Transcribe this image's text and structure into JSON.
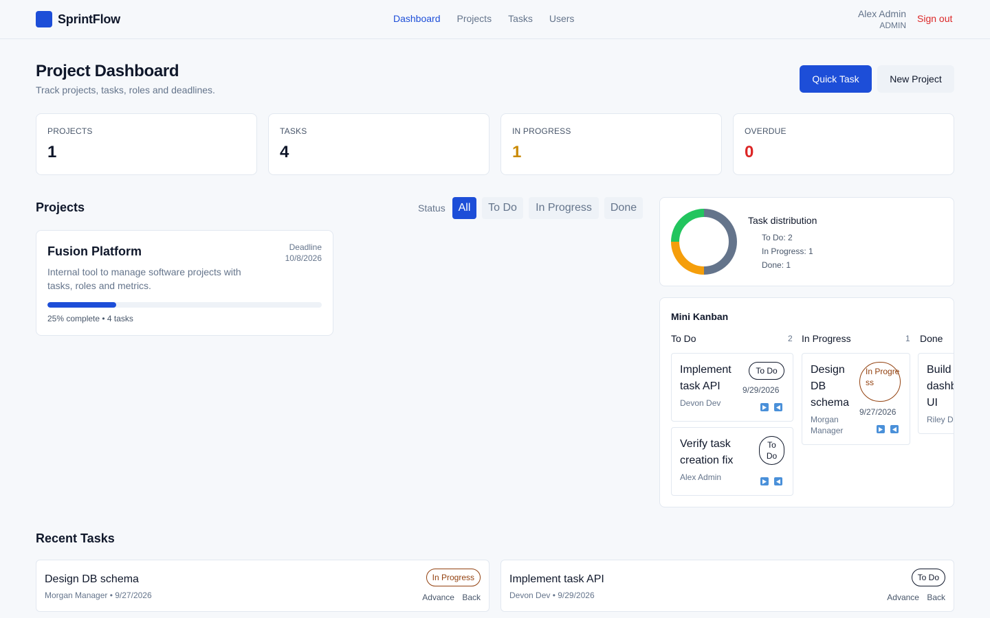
{
  "header": {
    "brand": "SprintFlow",
    "nav": [
      {
        "label": "Dashboard",
        "active": true
      },
      {
        "label": "Projects",
        "active": false
      },
      {
        "label": "Tasks",
        "active": false
      },
      {
        "label": "Users",
        "active": false
      }
    ],
    "user_name": "Alex Admin",
    "user_role": "ADMIN",
    "sign_out": "Sign out"
  },
  "page": {
    "title": "Project Dashboard",
    "subtitle": "Track projects, tasks, roles and deadlines.",
    "quick_task": "Quick Task",
    "new_project": "New Project"
  },
  "stats": [
    {
      "label": "PROJECTS",
      "value": "1",
      "color": "#0f172a"
    },
    {
      "label": "TASKS",
      "value": "4",
      "color": "#0f172a"
    },
    {
      "label": "IN PROGRESS",
      "value": "1",
      "color": "#ca8a04"
    },
    {
      "label": "OVERDUE",
      "value": "0",
      "color": "#dc2626"
    }
  ],
  "projects_section": {
    "title": "Projects",
    "status_label": "Status",
    "filters": [
      "All",
      "To Do",
      "In Progress",
      "Done"
    ],
    "active_filter": "All"
  },
  "project": {
    "name": "Fusion Platform",
    "description": "Internal tool to manage software projects with tasks, roles and metrics.",
    "deadline_label": "Deadline",
    "deadline": "10/8/2026",
    "progress": 0.25,
    "meta": "25% complete • 4 tasks"
  },
  "distribution": {
    "title": "Task distribution",
    "items": [
      "To Do: 2",
      "In Progress: 1",
      "Done: 1"
    ],
    "segments": [
      {
        "name": "To Do",
        "value": 2,
        "color": "#64748b"
      },
      {
        "name": "In Progress",
        "value": 1,
        "color": "#f59e0b"
      },
      {
        "name": "Done",
        "value": 1,
        "color": "#22c55e"
      }
    ]
  },
  "kanban": {
    "title": "Mini Kanban",
    "columns": [
      {
        "title": "To Do",
        "count": "2"
      },
      {
        "title": "In Progress",
        "count": "1"
      },
      {
        "title": "Done",
        "count": ""
      }
    ],
    "tasks": {
      "implement_api": {
        "name": "Implement task API",
        "who": "Devon Dev",
        "badge": "To Do",
        "date": "9/29/2026"
      },
      "verify_fix": {
        "name": "Verify task creation fix",
        "who": "Alex Admin",
        "badge": "To Do",
        "date": ""
      },
      "design_db": {
        "name": "Design DB schema",
        "who": "Morgan Manager",
        "badge": "In Progress",
        "date": "9/27/2026"
      },
      "build_ui": {
        "name": "Build dashboard UI",
        "who": "Riley Dev"
      }
    },
    "badge_wrapped": {
      "to_do": "To Do",
      "in_progress": "In Progre ss"
    }
  },
  "recent": {
    "title": "Recent Tasks",
    "advance": "Advance",
    "back": "Back",
    "items": [
      {
        "name": "Design DB schema",
        "meta": "Morgan Manager • 9/27/2026",
        "badge": "In Progress"
      },
      {
        "name": "Implement task API",
        "meta": "Devon Dev • 9/29/2026",
        "badge": "To Do"
      }
    ]
  },
  "colors": {
    "primary": "#1d4ed8",
    "danger": "#dc2626",
    "warning": "#ca8a04",
    "progress_badge": "#92400e"
  }
}
